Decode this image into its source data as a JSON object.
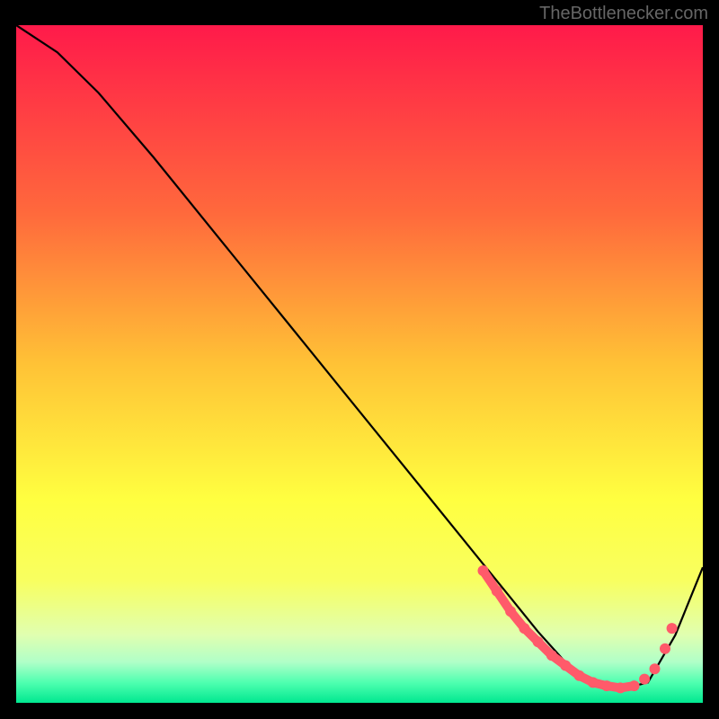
{
  "watermark": "TheBottlenecker.com",
  "chart_data": {
    "type": "line",
    "title": "",
    "xlabel": "",
    "ylabel": "",
    "xlim": [
      0,
      100
    ],
    "ylim": [
      0,
      100
    ],
    "gradient_stops": [
      {
        "offset": 0,
        "color": "#ff1a4a"
      },
      {
        "offset": 0.28,
        "color": "#ff6a3c"
      },
      {
        "offset": 0.5,
        "color": "#ffc236"
      },
      {
        "offset": 0.7,
        "color": "#ffff40"
      },
      {
        "offset": 0.82,
        "color": "#f8ff60"
      },
      {
        "offset": 0.9,
        "color": "#e0ffb0"
      },
      {
        "offset": 0.94,
        "color": "#b0ffc8"
      },
      {
        "offset": 0.97,
        "color": "#4fffb0"
      },
      {
        "offset": 1.0,
        "color": "#00e890"
      }
    ],
    "series": [
      {
        "name": "bottleneck-curve",
        "color": "#000000",
        "x": [
          0,
          6,
          12,
          20,
          30,
          40,
          50,
          60,
          68,
          72,
          76,
          80,
          84,
          88,
          92,
          96,
          100
        ],
        "y": [
          100,
          96,
          90,
          80.5,
          68,
          55.5,
          43,
          30.5,
          20.5,
          15.5,
          10.5,
          6,
          3,
          2,
          3,
          10,
          20
        ]
      }
    ],
    "points": {
      "name": "highlight-points",
      "color": "#ff5a6a",
      "x": [
        68,
        70,
        72,
        74,
        76,
        78,
        80,
        82,
        84,
        86,
        88,
        90,
        91.5,
        93,
        94.5,
        95.5
      ],
      "y": [
        19.5,
        16.5,
        13.5,
        11,
        9,
        7,
        5.5,
        4,
        3,
        2.5,
        2.2,
        2.5,
        3.5,
        5,
        8,
        11
      ]
    }
  }
}
